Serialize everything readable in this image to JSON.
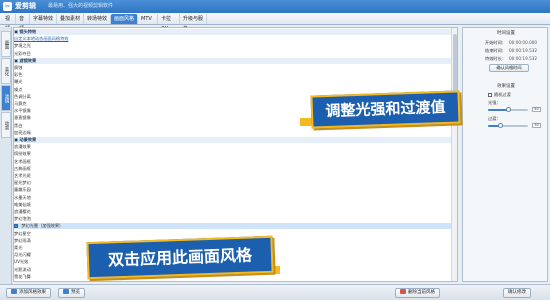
{
  "app": {
    "name": "爱剪辑",
    "slogan": "最易用、强大的视频剪辑软件"
  },
  "menu": [
    {
      "label": "视频",
      "active": false
    },
    {
      "label": "音频",
      "active": false
    },
    {
      "label": "字幕特效",
      "active": false
    },
    {
      "label": "叠加素材",
      "active": false
    },
    {
      "label": "转场特效",
      "active": false
    },
    {
      "label": "画面风格",
      "active": true
    },
    {
      "label": "MTV",
      "active": false
    },
    {
      "label": "卡拉OK",
      "active": false
    },
    {
      "label": "升级与服务",
      "active": false
    }
  ],
  "sidetabs": [
    "画面",
    "美化",
    "滤镜",
    "动景"
  ],
  "list": [
    {
      "text": "▣ 镜头特效",
      "kind": "group"
    },
    {
      "text": "   自定义本地动态画面风格特效",
      "kind": "link"
    },
    {
      "text": "      梦境之光",
      "kind": "item"
    },
    {
      "text": "      光彩夺目",
      "kind": "item"
    },
    {
      "text": "▣ 滤镜效果",
      "kind": "group"
    },
    {
      "text": "      腐蚀",
      "kind": "item"
    },
    {
      "text": "      彩色",
      "kind": "item"
    },
    {
      "text": "      曝光",
      "kind": "item"
    },
    {
      "text": "      噪点",
      "kind": "item"
    },
    {
      "text": "      色调分离",
      "kind": "item"
    },
    {
      "text": "      马赛克",
      "kind": "item"
    },
    {
      "text": "      水平镜像",
      "kind": "item"
    },
    {
      "text": "      垂直镜像",
      "kind": "item"
    },
    {
      "text": "      黑白",
      "kind": "item"
    },
    {
      "text": "      加亮边缘",
      "kind": "item"
    },
    {
      "text": "▣ 动景效果",
      "kind": "group"
    },
    {
      "text": "      浪漫效果",
      "kind": "item"
    },
    {
      "text": "      缤纷效果",
      "kind": "item"
    },
    {
      "text": "      艺术画框",
      "kind": "item"
    },
    {
      "text": "      古典画框",
      "kind": "item"
    },
    {
      "text": "      艺术光斑",
      "kind": "item"
    },
    {
      "text": "      星光梦幻",
      "kind": "item"
    },
    {
      "text": "      童趣乐园",
      "kind": "item"
    },
    {
      "text": "      水墨天地",
      "kind": "item"
    },
    {
      "text": "      唯美仙境",
      "kind": "item"
    },
    {
      "text": "      浪漫樱花",
      "kind": "item"
    },
    {
      "text": "      梦幻泡泡",
      "kind": "item"
    },
    {
      "text": "      梦幻光晕（加强效果）",
      "kind": "selected"
    },
    {
      "text": "      梦幻星空",
      "kind": "item"
    },
    {
      "text": "      梦幻雨滴",
      "kind": "item"
    },
    {
      "text": "      柔光",
      "kind": "item"
    },
    {
      "text": "      月光闪耀",
      "kind": "item"
    },
    {
      "text": "      UV光效",
      "kind": "item"
    },
    {
      "text": "      光影流动",
      "kind": "item"
    },
    {
      "text": "      雪花飞舞",
      "kind": "item"
    }
  ],
  "right": {
    "time_title": "时间设置",
    "start_label": "开始时间：",
    "start_value": "00:00:00.000",
    "end_label": "结束时间：",
    "end_value": "00:00:19.532",
    "duration_label": "特效时长：",
    "duration_value": "00:00:19.532",
    "confirm_button": "确认风格时间",
    "effect_title": "效果设置",
    "random_label": "随机过渡",
    "light_label": "光强：",
    "light_value": "50",
    "light_fraction": 0.5,
    "fade_label": "过渡：",
    "fade_value": "30",
    "fade_fraction": 0.3
  },
  "bottom": {
    "add_style": "添加风格效果",
    "play": "预览",
    "delete_style": "删除当前风格",
    "confirm_edit": "确认修改"
  },
  "callouts": {
    "adjust": "调整光强和过渡值",
    "double_click": "双击应用此画面风格"
  }
}
